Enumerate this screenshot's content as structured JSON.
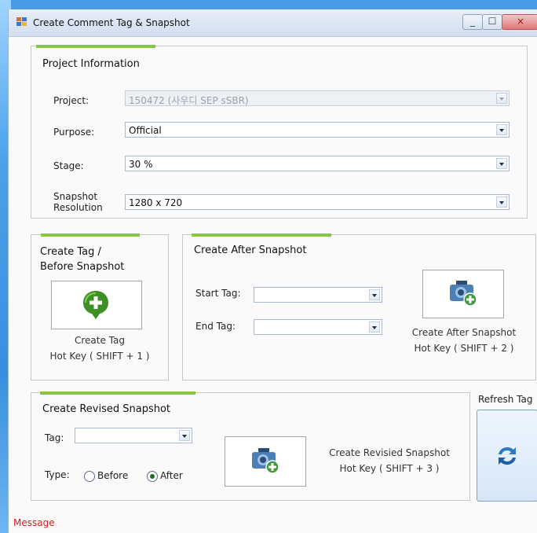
{
  "window": {
    "title": "Create Comment Tag & Snapshot",
    "min_symbol": "_",
    "max_symbol": "☐",
    "close_symbol": "×"
  },
  "project_info": {
    "title": "Project Information",
    "project_label": "Project:",
    "project_value": "150472 (사우디 SEP sSBR)",
    "purpose_label": "Purpose:",
    "purpose_value": "Official",
    "stage_label": "Stage:",
    "stage_value": "30 %",
    "resolution_label_1": "Snapshot",
    "resolution_label_2": "Resolution",
    "resolution_value": "1280 x 720"
  },
  "create_tag": {
    "title_1": "Create Tag /",
    "title_2": "Before Snapshot",
    "caption_1": "Create Tag",
    "caption_2": "Hot Key ( SHIFT + 1 )",
    "icon": "plus-circle-icon"
  },
  "after_snapshot": {
    "title": "Create After Snapshot",
    "start_label": "Start Tag:",
    "start_value": "",
    "end_label": "End Tag:",
    "end_value": "",
    "caption_1": "Create After Snapshot",
    "caption_2": "Hot Key ( SHIFT + 2 )",
    "icon": "camera-add-icon"
  },
  "revised_snapshot": {
    "title": "Create Revised Snapshot",
    "tag_label": "Tag:",
    "tag_value": "",
    "type_label": "Type:",
    "before_label": "Before",
    "after_label": "After",
    "selected_type": "After",
    "caption_1": "Create Revisied Snapshot",
    "caption_2": "Hot Key ( SHIFT + 3 )",
    "icon": "camera-add-icon"
  },
  "refresh": {
    "label": "Refresh Tag",
    "icon": "refresh-icon"
  },
  "status": {
    "message": "Message"
  },
  "colors": {
    "accent_green": "#8bc53f",
    "message_red": "#d21d1d",
    "desktop_blue": "#4a9be6"
  }
}
